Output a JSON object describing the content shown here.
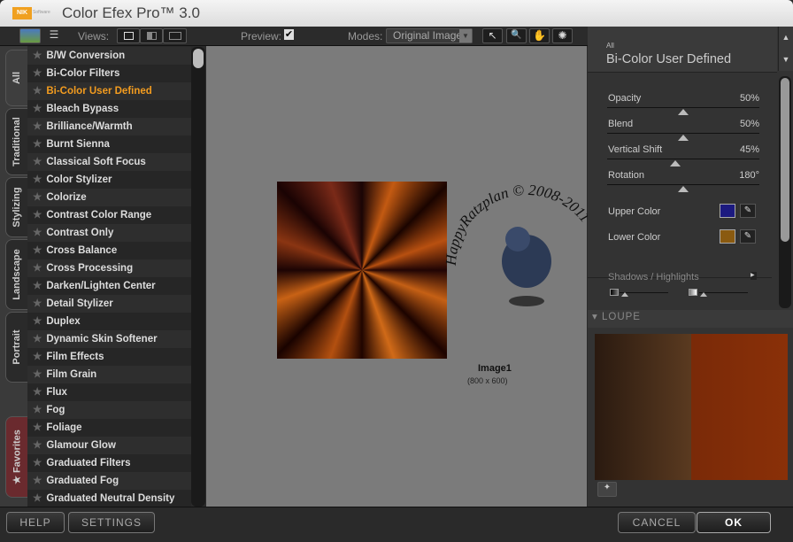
{
  "app": {
    "title": "Color Efex Pro™ 3.0",
    "logo": "nik",
    "logo_sub": "Software"
  },
  "toolbar": {
    "views_label": "Views:",
    "preview_label": "Preview:",
    "preview_checked": true,
    "modes_label": "Modes:",
    "modes_value": "Original Image"
  },
  "tabs": [
    "All",
    "Traditional",
    "Stylizing",
    "Landscape",
    "Portrait",
    "Favorites"
  ],
  "filters": [
    "B/W Conversion",
    "Bi-Color Filters",
    "Bi-Color User Defined",
    "Bleach Bypass",
    "Brilliance/Warmth",
    "Burnt Sienna",
    "Classical Soft Focus",
    "Color Stylizer",
    "Colorize",
    "Contrast Color Range",
    "Contrast Only",
    "Cross Balance",
    "Cross Processing",
    "Darken/Lighten Center",
    "Detail Stylizer",
    "Duplex",
    "Dynamic Skin Softener",
    "Film Effects",
    "Film Grain",
    "Flux",
    "Fog",
    "Foliage",
    "Glamour Glow",
    "Graduated Filters",
    "Graduated Fog",
    "Graduated Neutral Density"
  ],
  "selected_filter": "Bi-Color User Defined",
  "image": {
    "name": "Image1",
    "size": "(800 x 600)"
  },
  "watermark": "HappyRatzplan © 2008-2011",
  "panel": {
    "category": "All",
    "title": "Bi-Color User Defined",
    "sliders": [
      {
        "label": "Opacity",
        "value": "50%",
        "level": 0.5
      },
      {
        "label": "Blend",
        "value": "50%",
        "level": 0.5
      },
      {
        "label": "Vertical Shift",
        "value": "45%",
        "level": 0.45
      },
      {
        "label": "Rotation",
        "value": "180°",
        "level": 0.5
      }
    ],
    "upper_color_label": "Upper Color",
    "upper_color": "#1c1a80",
    "lower_color_label": "Lower Color",
    "lower_color": "#8a5a10",
    "shadows_label": "Shadows / Highlights",
    "loupe_label": "LOUPE"
  },
  "buttons": {
    "help": "HELP",
    "settings": "SETTINGS",
    "cancel": "CANCEL",
    "ok": "OK"
  },
  "colors": {
    "accent": "#f39c1f"
  }
}
